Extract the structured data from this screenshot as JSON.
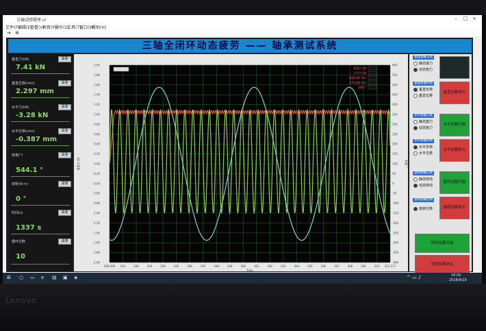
{
  "window": {
    "title": "三轴试验程序.vi"
  },
  "menu": [
    "文件(F)",
    "编辑(E)",
    "查看(V)",
    "项目(P)",
    "操作(O)",
    "工具(T)",
    "窗口(W)",
    "帮助(H)"
  ],
  "toolbar": {
    "run": "➔",
    "abort": "⊗"
  },
  "banner": {
    "title": "三轴全闭环动态疲劳 —— 轴承测试系统"
  },
  "left_panel": [
    {
      "label": "垂直力(kN)",
      "button": "清零",
      "value": "7.41 kN"
    },
    {
      "label": "垂直位移(mm)",
      "button": "清零",
      "value": "2.297 mm"
    },
    {
      "label": "水平力(kN)",
      "button": "清零",
      "value": "-3.28 kN"
    },
    {
      "label": "水平位移(mm)",
      "button": "清零",
      "value": "-0.387 mm"
    },
    {
      "label": "转角(°)",
      "button": "清零",
      "value": "544.1 °"
    },
    {
      "label": "转矩(N·m)",
      "button": "清零",
      "value": "0 °"
    },
    {
      "label": "时间(s)",
      "button": "清零",
      "value": "1337 s"
    },
    {
      "label": "循环次数",
      "button": "清零",
      "value": "10"
    }
  ],
  "chart_data": {
    "type": "line",
    "title": "",
    "legend": [
      "垂直力 kN",
      "水平力 kN",
      "垂直位移 mm",
      "水平位移 mm",
      "转角 °"
    ],
    "legend_position": "top-right",
    "y_ticks_left": [
      "2.00",
      "1.80",
      "1.60",
      "1.40",
      "1.20",
      "1.00",
      "0.80",
      "0.60",
      "0.40",
      "0.20",
      "0.00",
      "-0.20",
      "-0.40",
      "-0.60",
      "-0.80",
      "-1.00",
      "-1.20",
      "-1.40",
      "-1.60",
      "-1.80",
      "-2.00"
    ],
    "y_ticks_right": [
      "600",
      "550",
      "500",
      "450",
      "400",
      "350",
      "300",
      "250",
      "200",
      "150",
      "100",
      "50",
      "0",
      "-50",
      "-100",
      "-150",
      "-200",
      "-250",
      "-300",
      "-350",
      "-400"
    ],
    "x_ticks": [
      "290.506",
      "291",
      "292",
      "293",
      "294",
      "295",
      "296",
      "297",
      "298",
      "299",
      "300",
      "301",
      "302",
      "303",
      "304",
      "305",
      "306",
      "307",
      "308",
      "309",
      "310",
      "311.177"
    ],
    "x_label": "Time",
    "y_label_left": "垂直力 kN",
    "y_label_right": "转角 °",
    "x_range": [
      290.506,
      311.177
    ],
    "y_range": [
      -2.0,
      2.0
    ],
    "grid": true,
    "series": [
      {
        "name": "垂直力 kN",
        "color": "#e8514a",
        "kind": "flat",
        "level": 1.05,
        "ripple": 0.03
      },
      {
        "name": "垂直位移 mm",
        "color": "#8ed04a",
        "kind": "sine",
        "amp": 1.05,
        "offset": 0.05,
        "period": 0.6
      },
      {
        "name": "转角 °",
        "color": "#7fd6cc",
        "kind": "slow",
        "amp": 1.55,
        "period": 7.0,
        "offset": 0.0
      }
    ]
  },
  "right_panel": {
    "groups": [
      {
        "tag": "垂直加载方式",
        "opt1": "静态施力",
        "opt2": "动态施力",
        "btn": "",
        "btn_color": "#1e2a2a"
      },
      {
        "tag": "垂直加载控制",
        "opt1": "垂直负荷",
        "opt2": "垂直位移",
        "btn": "垂直加载停止",
        "btn_color": "#d23c3c"
      },
      {
        "tag": "水平加载方式",
        "opt1": "静态施力",
        "opt2": "动态施力",
        "btn": "水平加载开始",
        "btn_color": "#1fa238"
      },
      {
        "tag": "水平加载控制",
        "opt1": "水平负荷",
        "opt2": "水平位移",
        "btn": "水平加载停止",
        "btn_color": "#d23c3c"
      },
      {
        "tag": "旋转加载方式",
        "opt1": "静态转动",
        "opt2": "动态转动",
        "btn": "旋转加载开始",
        "btn_color": "#1fa238"
      },
      {
        "tag": "旋转加载控制",
        "opt1": "旋转位移",
        "opt2": "",
        "btn": "旋转加载停止",
        "btn_color": "#d23c3c"
      }
    ],
    "bottom_buttons": [
      {
        "label": "同时加载开始",
        "color": "#1fa238"
      },
      {
        "label": "同时加载停止",
        "color": "#d23c3c"
      }
    ]
  },
  "taskbar": {
    "time": "16:42",
    "date": "2018/4/19"
  }
}
